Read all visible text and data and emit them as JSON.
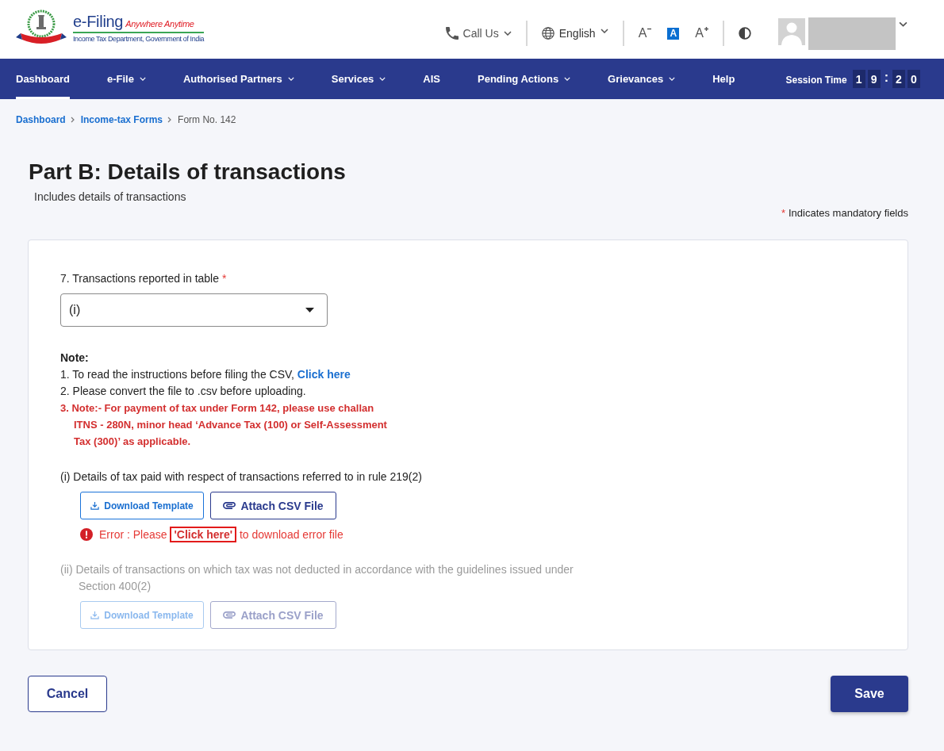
{
  "header": {
    "logo": {
      "title": "e-Filing",
      "tagline": "Anywhere Anytime",
      "subtitle": "Income Tax Department, Government of India"
    },
    "call_us": "Call Us",
    "language": "English",
    "font_sizes": [
      {
        "kind": "decrease",
        "label": "A",
        "selected": false
      },
      {
        "kind": "default",
        "label": "A",
        "selected": true
      },
      {
        "kind": "increase",
        "label": "A",
        "selected": false
      }
    ]
  },
  "nav": {
    "items": [
      {
        "label": "Dashboard",
        "dropdown": false,
        "selected": true
      },
      {
        "label": "e-File",
        "dropdown": true,
        "selected": false
      },
      {
        "label": "Authorised Partners",
        "dropdown": true,
        "selected": false
      },
      {
        "label": "Services",
        "dropdown": true,
        "selected": false
      },
      {
        "label": "AIS",
        "dropdown": false,
        "selected": false
      },
      {
        "label": "Pending Actions",
        "dropdown": true,
        "selected": false
      },
      {
        "label": "Grievances",
        "dropdown": true,
        "selected": false
      },
      {
        "label": "Help",
        "dropdown": false,
        "selected": false
      }
    ],
    "session_time": {
      "label": "Session Time",
      "minutes": [
        "1",
        "9"
      ],
      "separator": ":",
      "seconds": [
        "2",
        "0"
      ]
    }
  },
  "breadcrumb": [
    {
      "label": "Dashboard",
      "current": false
    },
    {
      "label": "Income-tax Forms",
      "current": false
    },
    {
      "label": "Form No. 142",
      "current": true
    }
  ],
  "page": {
    "title": "Part B: Details of transactions",
    "subtitle": "Includes details of transactions",
    "mandatory_note": {
      "marker": "*",
      "text": "Indicates mandatory fields"
    }
  },
  "form": {
    "question": {
      "label": "7. Transactions reported in table",
      "required_marker": "*"
    },
    "select": {
      "value": "(i)"
    },
    "note": {
      "title": "Note:",
      "items": [
        {
          "kind": "info",
          "text": "1. To read the instructions before filing the CSV,",
          "link": "Click here"
        },
        {
          "kind": "info",
          "text": "2. Please convert the file to .csv before uploading."
        },
        {
          "kind": "warning",
          "lines": [
            "3. Note:- For payment of tax under Form 142, please use challan",
            "ITNS - 280N, minor head ‘Advance Tax (100) or Self-Assessment",
            "Tax (300)’ as applicable."
          ]
        }
      ]
    },
    "sections": [
      {
        "label": "(i) Details of tax paid with respect of transactions referred to in rule 219(2)",
        "disabled": false,
        "buttons": [
          {
            "kind": "download",
            "label": "Download Template"
          },
          {
            "kind": "attach",
            "label": "Attach CSV File"
          }
        ],
        "error": {
          "prefix": "Error : Please",
          "link": "'Click here'",
          "suffix": "to download error file"
        }
      },
      {
        "label": "(ii) Details of transactions on which tax was not deducted in accordance with the guidelines issued under Section 400(2)",
        "disabled": true,
        "buttons": [
          {
            "kind": "download",
            "label": "Download Template"
          },
          {
            "kind": "attach",
            "label": "Attach CSV File"
          }
        ]
      }
    ]
  },
  "actions": [
    {
      "kind": "secondary",
      "label": "Cancel"
    },
    {
      "kind": "primary",
      "label": "Save"
    }
  ]
}
